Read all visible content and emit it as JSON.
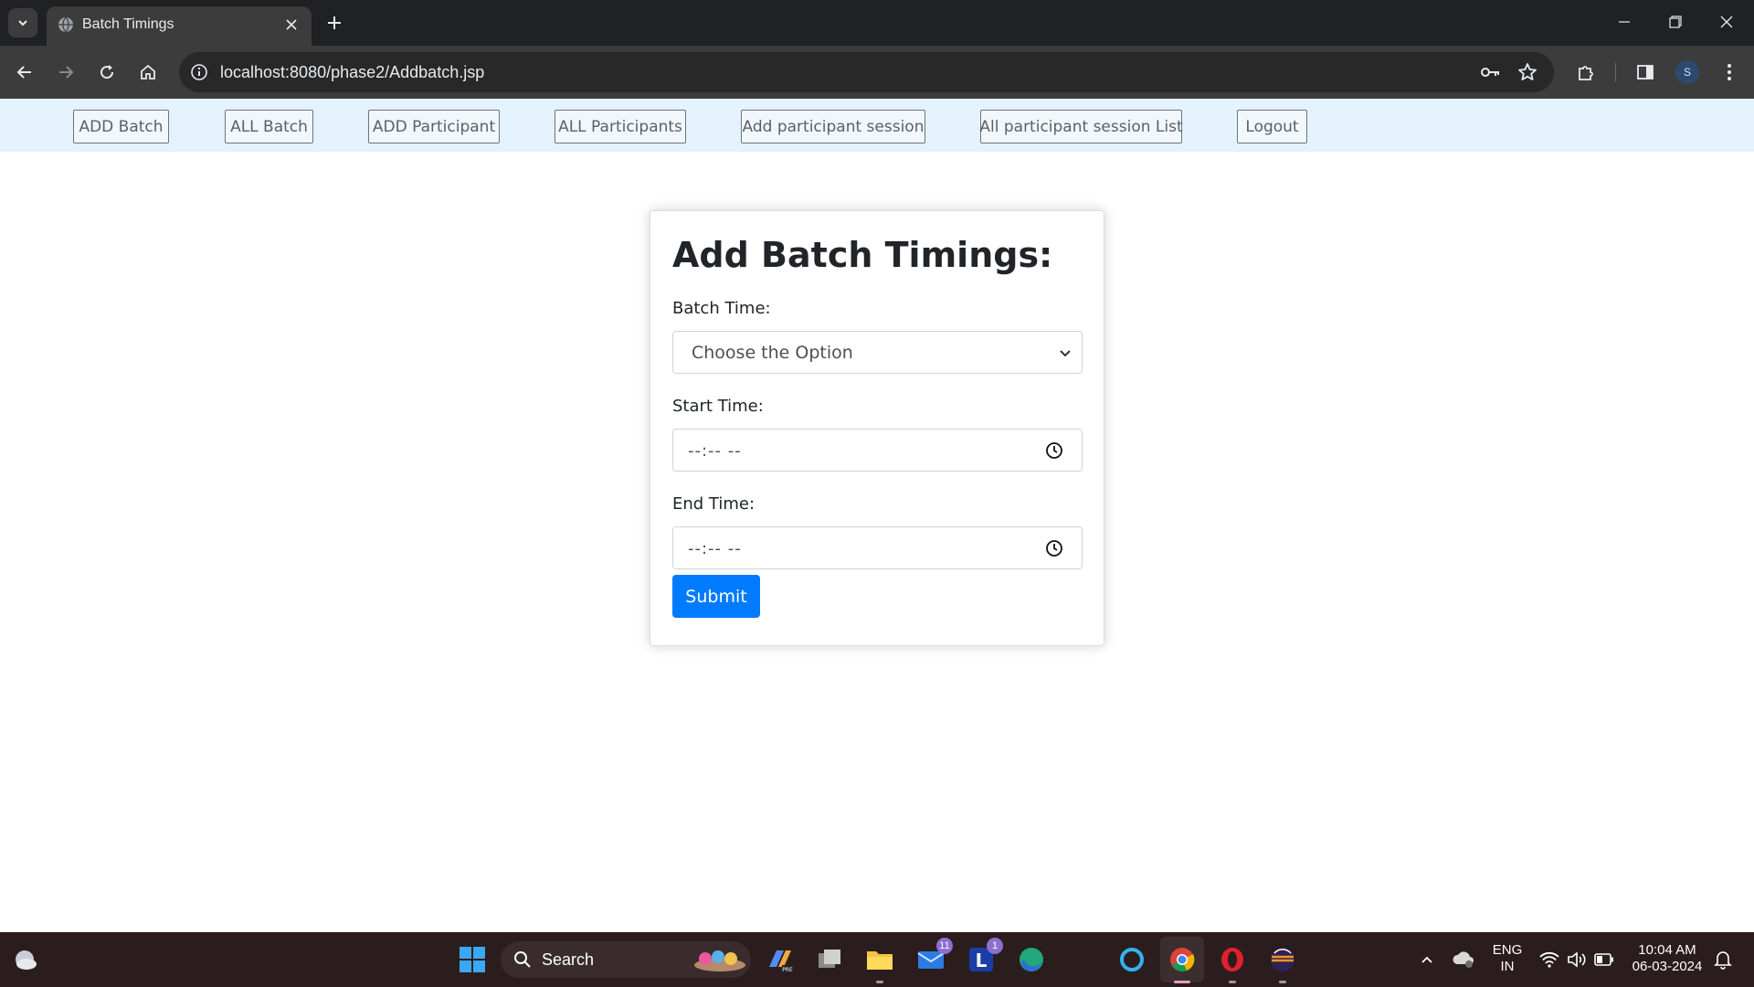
{
  "browser": {
    "tab_title": "Batch Timings",
    "url": "localhost:8080/phase2/Addbatch.jsp",
    "profile_initial": "S"
  },
  "nav": {
    "links": [
      "ADD Batch",
      "ALL Batch",
      "ADD Participant",
      "ALL Participants",
      "Add participant session",
      "All participant session List",
      "Logout"
    ]
  },
  "form": {
    "title": "Add Batch Timings:",
    "batch_time_label": "Batch Time:",
    "batch_time_value": "Choose the Option",
    "start_time_label": "Start Time:",
    "start_time_value": "--:-- --",
    "end_time_label": "End Time:",
    "end_time_value": "--:-- --",
    "submit_label": "Submit"
  },
  "colors": {
    "navbar_bg": "#e3f2fd",
    "primary": "#007bff",
    "chrome_dark": "#202124",
    "taskbar_bg": "#2b1d1d"
  },
  "taskbar": {
    "search_text": "Search",
    "mail_badge": "11",
    "loop_badge": "1",
    "language": "ENG",
    "region": "IN",
    "time": "10:04 AM",
    "date": "06-03-2024"
  }
}
